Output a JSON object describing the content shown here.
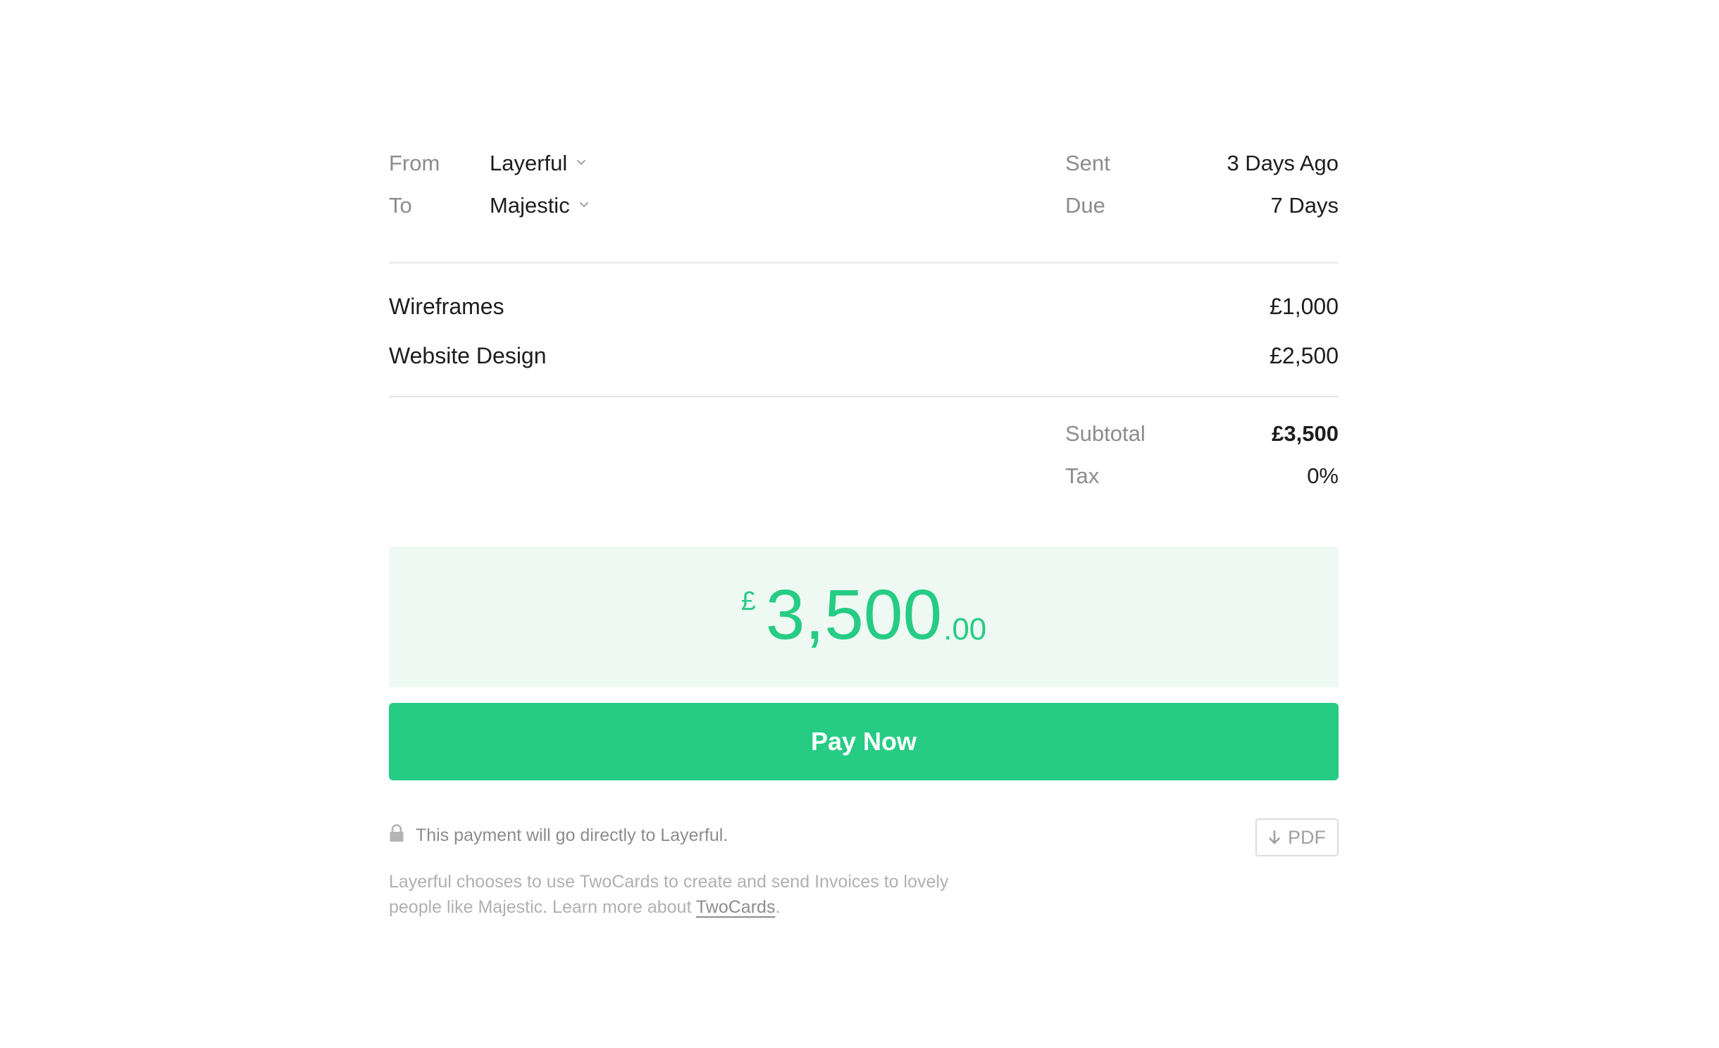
{
  "header": {
    "from_label": "From",
    "from_value": "Layerful",
    "to_label": "To",
    "to_value": "Majestic",
    "sent_label": "Sent",
    "sent_value": "3 Days Ago",
    "due_label": "Due",
    "due_value": "7 Days"
  },
  "line_items": [
    {
      "description": "Wireframes",
      "amount": "£1,000"
    },
    {
      "description": "Website Design",
      "amount": "£2,500"
    }
  ],
  "totals": {
    "subtotal_label": "Subtotal",
    "subtotal_value": "£3,500",
    "tax_label": "Tax",
    "tax_value": "0%"
  },
  "total": {
    "currency": "£",
    "whole": "3,500",
    "decimal": ".00"
  },
  "pay_button": {
    "label": "Pay Now"
  },
  "footer": {
    "secure_text": "This payment will go directly to Layerful.",
    "pdf_label": "PDF",
    "note_text": "Layerful chooses to use TwoCards to create and send Invoices to lovely people like Majestic. Learn more about ",
    "note_link": "TwoCards",
    "note_end": "."
  },
  "icons": {
    "chevron": "chevron-down-icon",
    "lock": "lock-icon",
    "download": "download-arrow-icon"
  },
  "colors": {
    "accent": "#26cc84",
    "amount_bg": "#eef9f3",
    "muted": "#8c8c8c",
    "text": "#1d1d1f"
  }
}
